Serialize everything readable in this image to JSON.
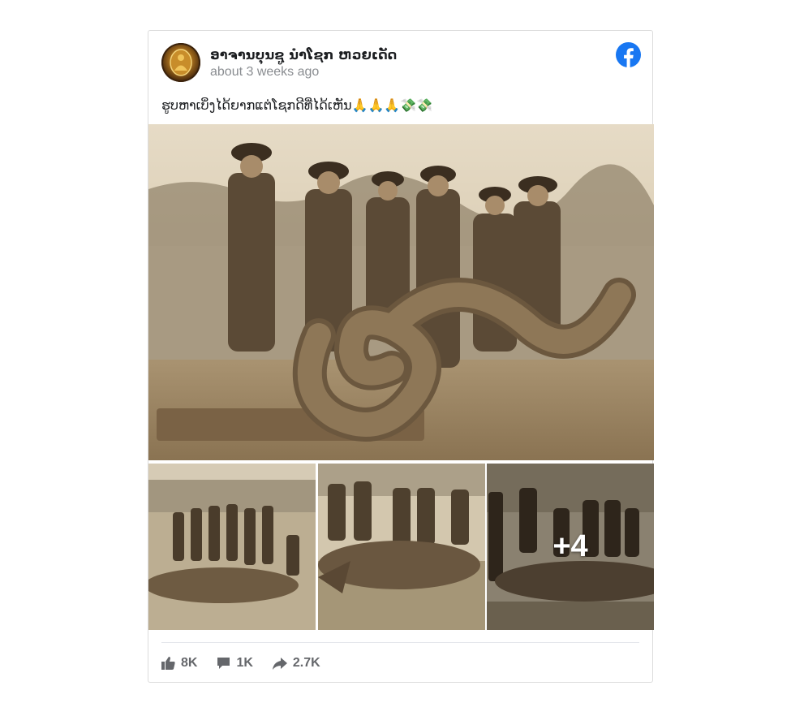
{
  "post": {
    "author": "ອາຈານບຸນຊູ ນໍາໂຊກ ຫວຍເດັດ",
    "time": "about 3 weeks ago",
    "caption": "ຮູບຫາເບິ່ງໄດ້ຍາກແຕ່ໂຊກດີທີ່ໄດ້ເຫັນ🙏🙏🙏💸💸",
    "more_count": "+4"
  },
  "stats": {
    "likes": "8K",
    "comments": "1K",
    "shares": "2.7K"
  },
  "colors": {
    "facebook_blue": "#1877f2",
    "stat_gray": "#65676b",
    "time_gray": "#8a8d91"
  },
  "icons": [
    "facebook-icon",
    "like-icon",
    "comment-icon",
    "share-icon"
  ]
}
